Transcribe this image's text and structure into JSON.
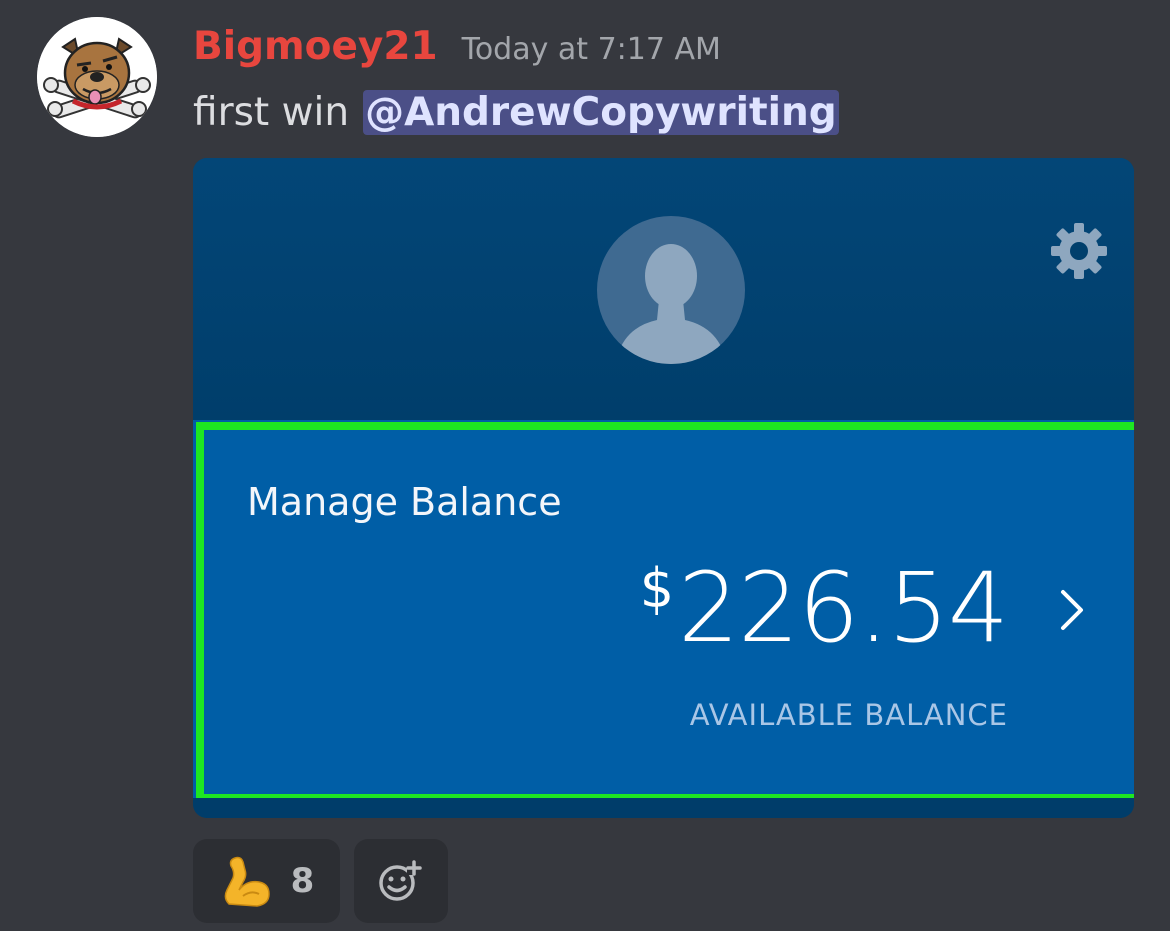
{
  "message": {
    "author": "Bigmoey21",
    "timestamp": "Today at 7:17 AM",
    "text": "first win",
    "mention": "@AndrewCopywriting",
    "author_color": "#e8463e",
    "avatar_icon": "bulldog-avatar"
  },
  "attachment": {
    "manage_label": "Manage Balance",
    "currency": "$",
    "amount": "226.54",
    "available_label": "AVAILABLE BALANCE",
    "accent_frame_color": "#1ee622",
    "profile_icon": "default-profile-icon",
    "settings_icon": "gear-icon",
    "arrow_icon": "chevron-right-icon"
  },
  "reactions": [
    {
      "emoji": "flexed-biceps",
      "count": "8"
    }
  ],
  "add_reaction_icon": "add-reaction-icon"
}
